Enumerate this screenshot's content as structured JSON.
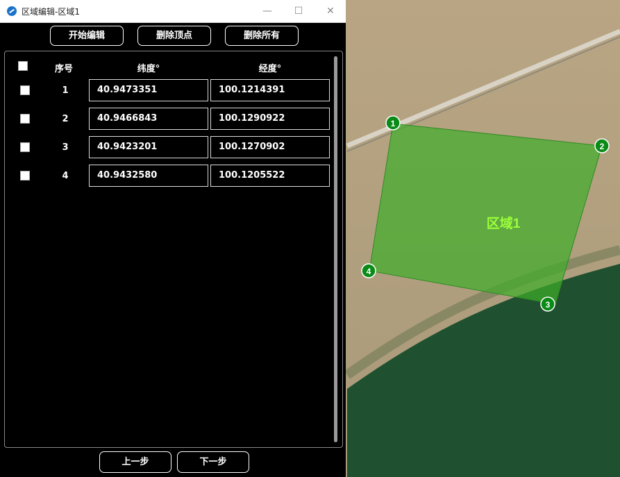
{
  "window": {
    "title": "区域编辑-区域1",
    "minimize": "—",
    "maximize": "☐",
    "close": "✕"
  },
  "toolbar": {
    "start_edit": "开始编辑",
    "delete_vertex": "删除顶点",
    "delete_all": "删除所有"
  },
  "table": {
    "headers": {
      "index": "序号",
      "lat": "纬度°",
      "lng": "经度°"
    },
    "rows": [
      {
        "index": "1",
        "lat": "40.9473351",
        "lng": "100.1214391"
      },
      {
        "index": "2",
        "lat": "40.9466843",
        "lng": "100.1290922"
      },
      {
        "index": "3",
        "lat": "40.9423201",
        "lng": "100.1270902"
      },
      {
        "index": "4",
        "lat": "40.9432580",
        "lng": "100.1205522"
      }
    ]
  },
  "nav": {
    "prev": "上一步",
    "next": "下一步"
  },
  "map": {
    "region_label": "区域1",
    "vertices": [
      "1",
      "2",
      "3",
      "4"
    ],
    "region_fill": "#3fae2a",
    "label_color": "#9cff3a",
    "marker_color": "#0a8a17"
  }
}
